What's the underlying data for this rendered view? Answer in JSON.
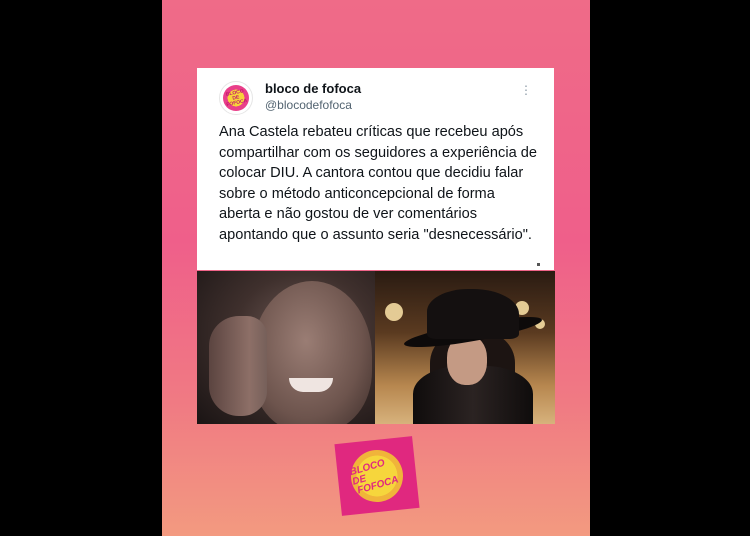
{
  "tweet": {
    "display_name": "bloco de fofoca",
    "handle": "@blocodefofoca",
    "text": "Ana Castela rebateu críticas que recebeu após compartilhar com os seguidores a experiência de colocar DIU. A cantora contou que decidiu falar sobre o método anticoncepcional de forma aberta e não gostou de ver comentários apontando que o assunto seria \"desnecessário\".",
    "more_icon": "⋮",
    "avatar_text": "BLOCO DE FOFOCA"
  },
  "sticker": {
    "line1": "BLOCO DE",
    "line2": "FOFOCA"
  },
  "colors": {
    "background_top": "#ef6b88",
    "background_bottom": "#f39a80",
    "brand_pink": "#e0287f",
    "brand_yellow": "#f6d63c"
  }
}
